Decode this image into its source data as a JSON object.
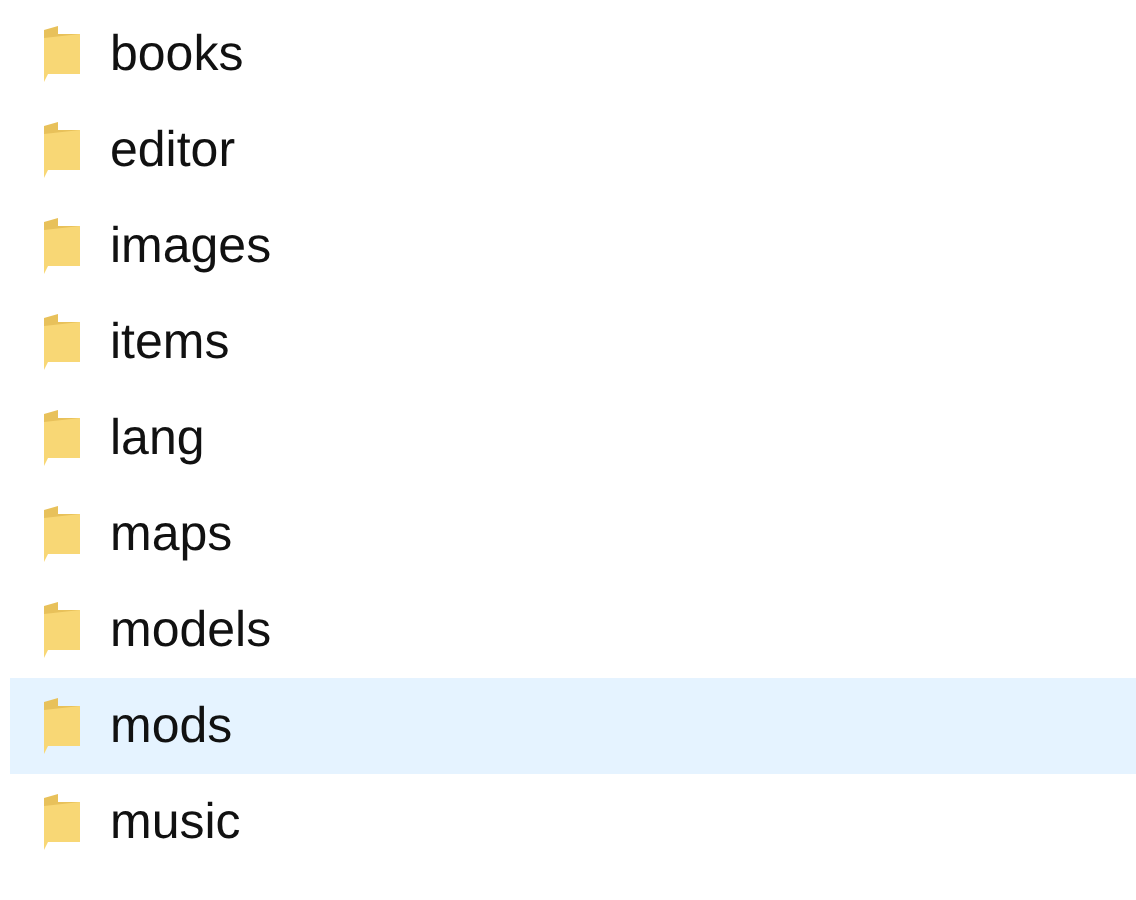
{
  "folders": [
    {
      "name": "books",
      "selected": false
    },
    {
      "name": "editor",
      "selected": false
    },
    {
      "name": "images",
      "selected": false
    },
    {
      "name": "items",
      "selected": false
    },
    {
      "name": "lang",
      "selected": false
    },
    {
      "name": "maps",
      "selected": false
    },
    {
      "name": "models",
      "selected": false
    },
    {
      "name": "mods",
      "selected": true
    },
    {
      "name": "music",
      "selected": false
    }
  ]
}
